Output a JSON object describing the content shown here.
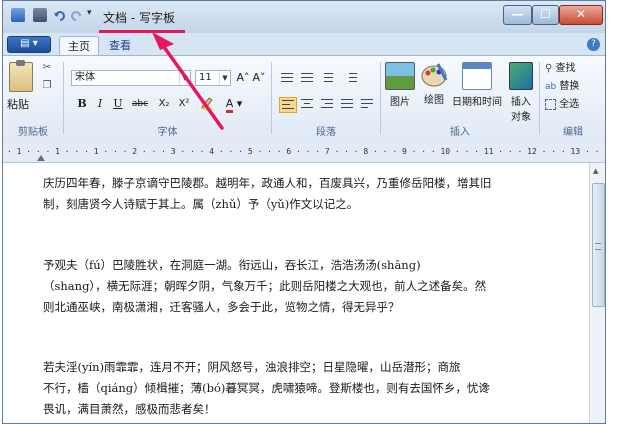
{
  "window": {
    "title": "文档 - 写字板",
    "controls": {
      "minimize": "—",
      "maximize": "☐",
      "close": "✕"
    }
  },
  "ribbon_tabs": {
    "app_menu": "▤ ▾",
    "home": "主页",
    "view": "查看"
  },
  "clipboard": {
    "paste": "粘贴",
    "group_label": "剪贴板"
  },
  "font": {
    "family": "宋体",
    "size": "11",
    "grow": "A˄",
    "shrink": "A˅",
    "bold": "B",
    "italic": "I",
    "underline": "U",
    "strike": "abc",
    "subscript": "X₂",
    "superscript": "X²",
    "highlight_icon": "highlighter-icon",
    "color": "A",
    "group_label": "字体"
  },
  "paragraph": {
    "group_label": "段落"
  },
  "insert": {
    "picture": "图片",
    "paint": "绘图",
    "datetime": "日期和时间",
    "object_line1": "插入",
    "object_line2": "对象",
    "group_label": "插入"
  },
  "editing": {
    "find": "查找",
    "replace": "替换",
    "select_all": "全选",
    "group_label": "编辑"
  },
  "ruler": {
    "text": "· 1 · · · 1 · · · 1 · · · 2 · · · 3 · · · 4 · · · 5 · · · 6 · · · 7 · · · 8 · · · 9 · · · 10 · · · 11 · · · 12 · · · 13 · · · 14 · · · 15 · · · 16 ·"
  },
  "document": {
    "paragraphs": [
      "庆历四年春，滕子京谪守巴陵郡。越明年，政通人和，百废具兴，乃重修岳阳楼，增其旧\n制，刻唐贤今人诗赋于其上。属（zhǔ）予（yǔ)作文以记之。",
      "    予观夫（fú）巴陵胜状，在洞庭一湖。衔远山，吞长江，浩浩汤汤(shāng)\n（shang），横无际涯；朝晖夕阴，气象万千；此则岳阳楼之大观也，前人之述备矣。然\n则北通巫峡，南极潇湘，迁客骚人，多会于此，览物之情，得无异乎？",
      "    若夫淫(yín)雨霏霏，连月不开；阴风怒号，浊浪排空；日星隐曜，山岳潜形；商旅\n不行，樯（qiáng）倾楫摧；薄(bó)暮冥冥，虎啸猿啼。登斯楼也，则有去国怀乡，忧谗\n畏讥，满目萧然，感极而悲者矣！"
    ]
  },
  "colors": {
    "annotation": "#e7185a",
    "title_bar": "#c3d5ea",
    "app_button": "#1c4e9c"
  }
}
